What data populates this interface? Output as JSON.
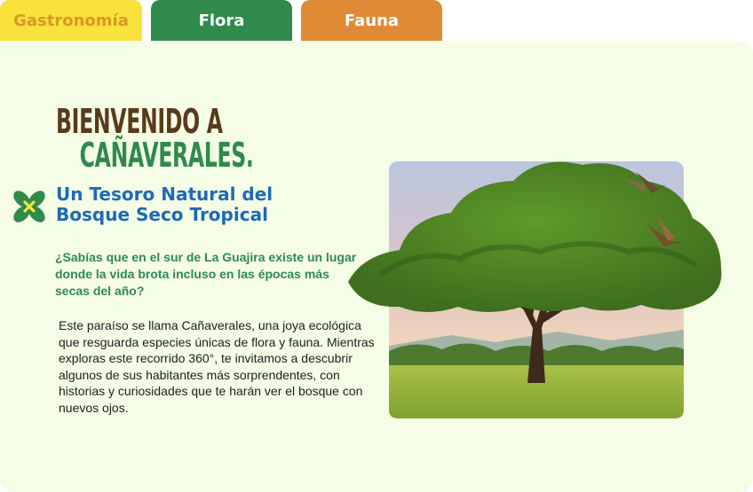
{
  "tabs": {
    "gastronomia": "Gastronomía",
    "flora": "Flora",
    "fauna": "Fauna"
  },
  "colors": {
    "tab_gastronomia_bg": "#f9e23b",
    "tab_gastronomia_text": "#d8962a",
    "tab_flora_bg": "#2f8a4c",
    "tab_fauna_bg": "#e08a35",
    "panel_bg": "#f5fde6",
    "heading_brown": "#5a3a1c",
    "heading_green": "#2f8a4c",
    "title_blue": "#1d6ab8"
  },
  "header": {
    "welcome_line1": "BIENVENIDO A",
    "welcome_line2": "CAÑAVERALES."
  },
  "section": {
    "icon": "green-yellow-flower-icon",
    "title": "Un Tesoro Natural del Bosque Seco Tropical",
    "question": "¿Sabías que en el sur de La Guajira existe un lugar donde la vida brota incluso en las épocas más secas del año?",
    "body": "Este paraíso se llama Cañaverales, una joya ecológica que resguarda especies únicas de flora y fauna. Mientras exploras este recorrido 360°, te invitamos a descubrir algunos de sus habitantes más sorprendentes, con historias y curiosidades que te harán ver el bosque con nuevos ojos."
  }
}
